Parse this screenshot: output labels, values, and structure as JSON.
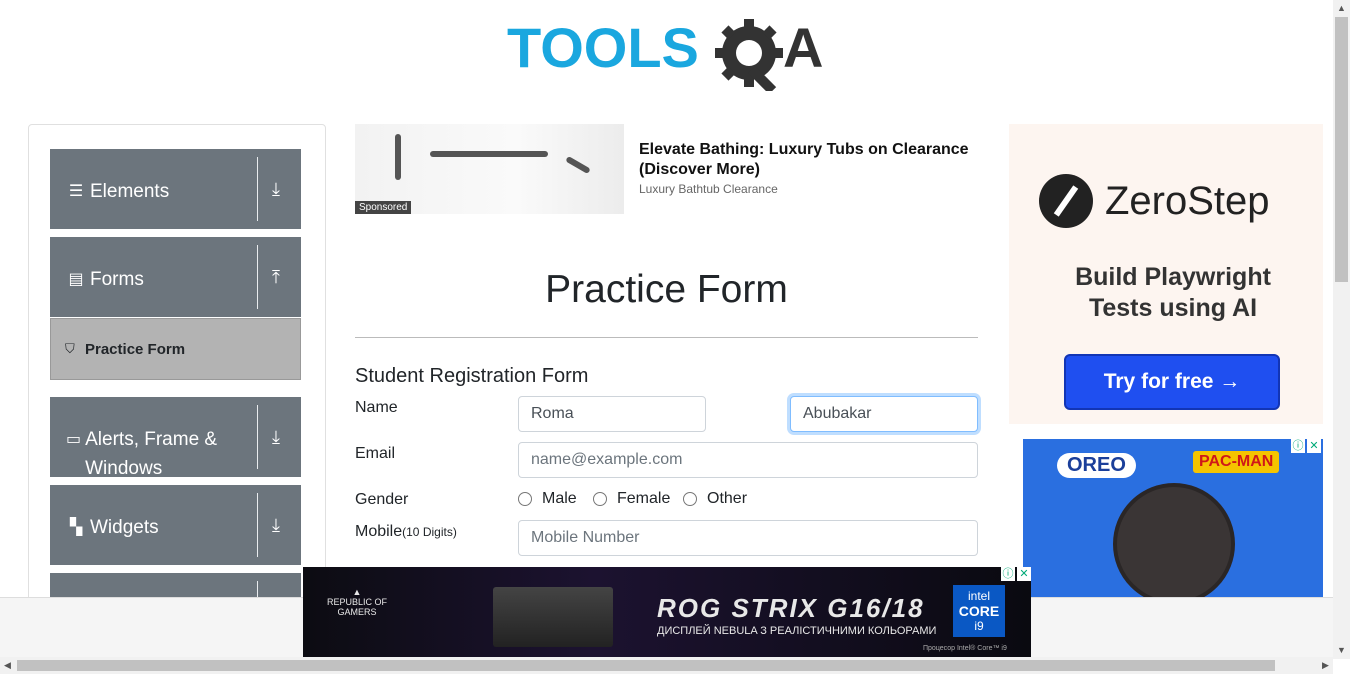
{
  "logo": {
    "text_a": "TOOLS",
    "text_b": "A"
  },
  "sidebar": {
    "groups": [
      {
        "label": "Elements",
        "icon": "hamburger-icon",
        "arrow": "⤓"
      },
      {
        "label": "Forms",
        "icon": "document-icon",
        "arrow": "⤒"
      },
      {
        "label": "Alerts, Frame & Windows",
        "icon": "window-icon",
        "arrow": "⤓"
      },
      {
        "label": "Widgets",
        "icon": "widgets-icon",
        "arrow": "⤓"
      }
    ],
    "active_item": "Practice Form"
  },
  "sponsored_ad": {
    "tag": "Sponsored",
    "title": "Elevate Bathing: Luxury Tubs on Clearance (Discover More)",
    "subtitle": "Luxury Bathtub Clearance"
  },
  "page": {
    "title": "Practice Form",
    "form_title": "Student Registration Form",
    "name_label": "Name",
    "first_name_value": "Roma",
    "last_name_value": "Abubakar",
    "email_label": "Email",
    "email_placeholder": "name@example.com",
    "gender_label": "Gender",
    "gender_options": [
      "Male",
      "Female",
      "Other"
    ],
    "mobile_label": "Mobile",
    "mobile_hint": "(10 Digits)",
    "mobile_placeholder": "Mobile Number"
  },
  "right_ad": {
    "brand": "ZeroStep",
    "headline": "Build Playwright Tests using AI",
    "cta": "Try for free →"
  },
  "oreo_ad": {
    "brand": "OREO",
    "partner": "PAC-MAN"
  },
  "bottom_ad": {
    "logo_text": "REPUBLIC OF GAMERS",
    "headline": "ROG STRIX G16/18",
    "subline": "ДИСПЛЕЙ NEBULA З РЕАЛІСТИЧНИМИ КОЛЬОРАМИ",
    "intel_brand": "intel",
    "intel_core": "CORE",
    "intel_tier": "i9",
    "footnote": "Процесор Intel® Core™ i9"
  },
  "colors": {
    "sidebar_group": "#6c757d",
    "active_item": "#b3b3b3",
    "cta": "#1f4ff0",
    "logo_blue": "#1aa7df",
    "logo_dark": "#333333"
  }
}
